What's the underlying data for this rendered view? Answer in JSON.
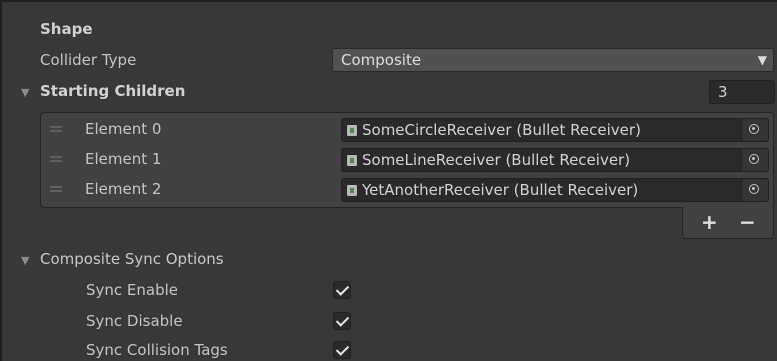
{
  "shape": {
    "header": "Shape",
    "collider_type_label": "Collider Type",
    "collider_type_value": "Composite"
  },
  "starting_children": {
    "label": "Starting Children",
    "count": "3",
    "elements": [
      {
        "label": "Element 0",
        "value": "SomeCircleReceiver (Bullet Receiver)"
      },
      {
        "label": "Element 1",
        "value": "SomeLineReceiver (Bullet Receiver)"
      },
      {
        "label": "Element 2",
        "value": "YetAnotherReceiver (Bullet Receiver)"
      }
    ],
    "add_symbol": "+",
    "remove_symbol": "−"
  },
  "composite_sync": {
    "label": "Composite Sync Options",
    "options": [
      {
        "label": "Sync Enable",
        "checked": true
      },
      {
        "label": "Sync Disable",
        "checked": true
      },
      {
        "label": "Sync Collision Tags",
        "checked": true
      }
    ]
  },
  "icons": {
    "foldout": "triangle-down-icon",
    "dropdown": "caret-down-icon",
    "object_picker": "target-circle-icon",
    "script_asset": "script-asset-icon",
    "drag_handle": "drag-handle-icon"
  }
}
